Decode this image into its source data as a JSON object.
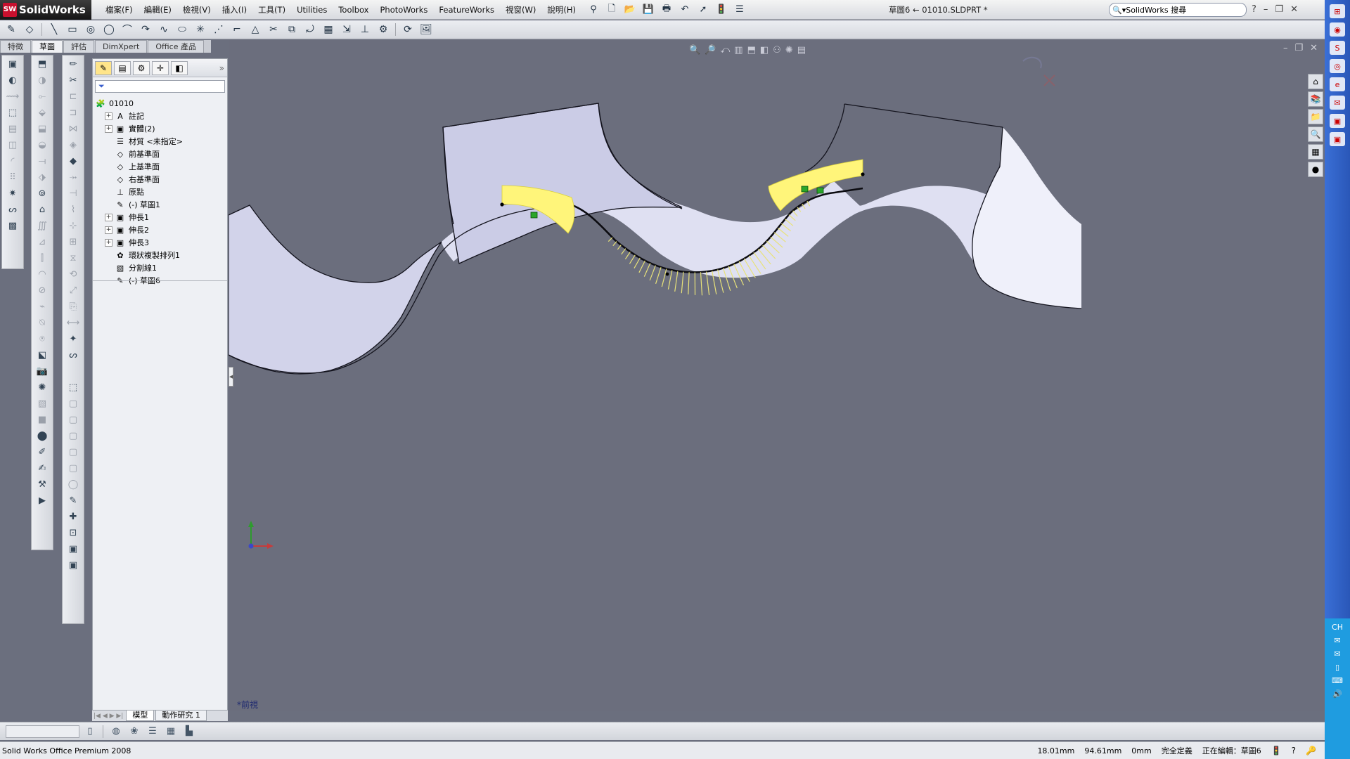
{
  "app": {
    "brand": "SolidWorks",
    "title": "草圖6 ← 01010.SLDPRT *"
  },
  "menu": [
    "檔案(F)",
    "編輯(E)",
    "檢視(V)",
    "插入(I)",
    "工具(T)",
    "Utilities",
    "Toolbox",
    "PhotoWorks",
    "FeatureWorks",
    "視窗(W)",
    "說明(H)"
  ],
  "search": {
    "text": "SolidWorks 搜尋"
  },
  "command_tabs": [
    "特徵",
    "草圖",
    "評估",
    "DimXpert",
    "Office 產品"
  ],
  "command_tabs_active": "草圖",
  "tree": {
    "root": "01010",
    "items": [
      {
        "label": "註記",
        "expandable": true,
        "icon": "annotation-icon"
      },
      {
        "label": "實體(2)",
        "expandable": true,
        "icon": "solid-bodies-icon"
      },
      {
        "label": "材質 <未指定>",
        "expandable": false,
        "icon": "material-icon"
      },
      {
        "label": "前基準面",
        "expandable": false,
        "icon": "plane-icon"
      },
      {
        "label": "上基準面",
        "expandable": false,
        "icon": "plane-icon"
      },
      {
        "label": "右基準面",
        "expandable": false,
        "icon": "plane-icon"
      },
      {
        "label": "原點",
        "expandable": false,
        "icon": "origin-icon"
      },
      {
        "label": "(-) 草圖1",
        "expandable": false,
        "icon": "sketch-icon"
      },
      {
        "label": "伸長1",
        "expandable": true,
        "icon": "extrude-icon"
      },
      {
        "label": "伸長2",
        "expandable": true,
        "icon": "extrude-icon"
      },
      {
        "label": "伸長3",
        "expandable": true,
        "icon": "extrude-icon"
      },
      {
        "label": "環狀複製排列1",
        "expandable": false,
        "icon": "circular-pattern-icon"
      },
      {
        "label": "分割線1",
        "expandable": false,
        "icon": "split-line-icon"
      },
      {
        "label": "(-) 草圖6",
        "expandable": false,
        "icon": "sketch-icon"
      }
    ]
  },
  "bottom_tabs": [
    "模型",
    "動作研究 1"
  ],
  "viewport": {
    "view_label": "*前視"
  },
  "status": {
    "product": "Solid Works Office Premium 2008",
    "x": "18.01mm",
    "y": "94.61mm",
    "z": "0mm",
    "state": "完全定義",
    "editing": "正在編輯：草圖6"
  },
  "colors": {
    "viewport_bg": "#6b6e7d",
    "face_highlight": "#fff57a",
    "curvature_comb": "#e8e27a"
  }
}
